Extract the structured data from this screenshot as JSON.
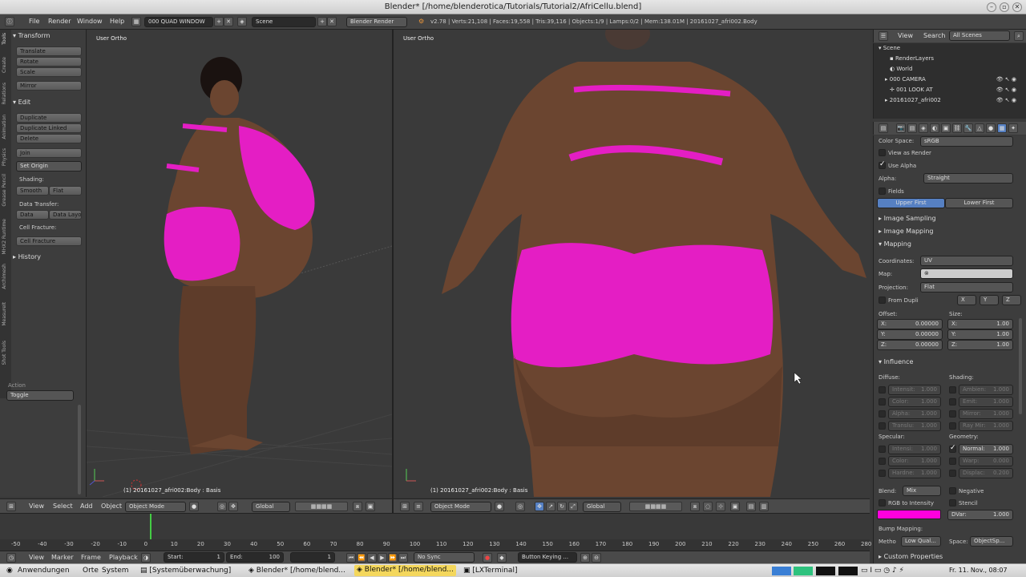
{
  "window": {
    "title": "Blender* [/home/blenderotica/Tutorials/Tutorial2/AfriCellu.blend]"
  },
  "info_header": {
    "menus": [
      "File",
      "Render",
      "Window",
      "Help"
    ],
    "layout": "000 QUAD WINDOW",
    "scene": "Scene",
    "engine": "Blender Render",
    "stats": "v2.78 | Verts:21,108 | Faces:19,558 | Tris:39,116 | Objects:1/9 | Lamps:0/2 | Mem:138.01M | 20161027_afri002.Body"
  },
  "toolshelf": {
    "tabs": [
      "Tools",
      "Create",
      "Relations",
      "Animation",
      "Physics",
      "Grease Pencil",
      "MHX2 Runtime",
      "Archimesh",
      "MeasureIt",
      "Shot Tools"
    ],
    "transform_header": "Transform",
    "transform_buttons": [
      "Translate",
      "Rotate",
      "Scale",
      "Mirror"
    ],
    "edit_header": "Edit",
    "edit_buttons": [
      "Duplicate",
      "Duplicate Linked",
      "Delete",
      "Join"
    ],
    "set_origin": "Set Origin",
    "shading_label": "Shading:",
    "smooth": "Smooth",
    "flat": "Flat",
    "data_transfer_label": "Data Transfer:",
    "data": "Data",
    "data_layo": "Data Layo",
    "cell_fracture_label": "Cell Fracture:",
    "cell_fracture": "Cell Fracture",
    "history_header": "History",
    "action_label": "Action",
    "toggle": "Toggle"
  },
  "viewport_left": {
    "label": "User Ortho",
    "object_info": "(1) 20161027_afri002:Body : Basis"
  },
  "viewport_right": {
    "label": "User Ortho",
    "object_info": "(1) 20161027_afri002:Body : Basis"
  },
  "viewport_header": {
    "view": "View",
    "select": "Select",
    "add": "Add",
    "object": "Object",
    "mode": "Object Mode",
    "orientation": "Global"
  },
  "timeline": {
    "ticks": [
      "-50",
      "-40",
      "-30",
      "-20",
      "-10",
      "0",
      "10",
      "20",
      "30",
      "40",
      "50",
      "60",
      "70",
      "80",
      "90",
      "100",
      "110",
      "120",
      "130",
      "140",
      "150",
      "160",
      "170",
      "180",
      "190",
      "200",
      "210",
      "220",
      "230",
      "240",
      "250",
      "260",
      "280"
    ],
    "view": "View",
    "marker": "Marker",
    "frame": "Frame",
    "playback": "Playback",
    "start": "Start:",
    "start_val": "1",
    "end": "End:",
    "end_val": "100",
    "current": "1",
    "sync": "No Sync",
    "keying": "Button Keying ..."
  },
  "outliner": {
    "view": "View",
    "search": "Search",
    "scenes": "All Scenes",
    "items": [
      "Scene",
      "RenderLayers",
      "World",
      "000 CAMERA",
      "001 LOOK AT",
      "20161027_afri002"
    ]
  },
  "properties": {
    "color_space_label": "Color Space:",
    "color_space": "sRGB",
    "view_as_render": "View as Render",
    "use_alpha": "Use Alpha",
    "alpha_label": "Alpha:",
    "alpha": "Straight",
    "fields": "Fields",
    "upper_first": "Upper First",
    "lower_first": "Lower First",
    "image_sampling": "Image Sampling",
    "image_mapping": "Image Mapping",
    "mapping": "Mapping",
    "coordinates_label": "Coordinates:",
    "coordinates": "UV",
    "map_label": "Map:",
    "projection_label": "Projection:",
    "projection": "Flat",
    "from_dupli": "From Dupli",
    "axes": [
      "X",
      "Y",
      "Z"
    ],
    "offset_label": "Offset:",
    "size_label": "Size:",
    "offset": [
      {
        "axis": "X:",
        "val": "0.00000"
      },
      {
        "axis": "Y:",
        "val": "0.00000"
      },
      {
        "axis": "Z:",
        "val": "0.00000"
      }
    ],
    "size": [
      {
        "axis": "X:",
        "val": "1.00"
      },
      {
        "axis": "Y:",
        "val": "1.00"
      },
      {
        "axis": "Z:",
        "val": "1.00"
      }
    ],
    "influence": "Influence",
    "diffuse_label": "Diffuse:",
    "shading_label": "Shading:",
    "diffuse": [
      {
        "name": "Intensit:",
        "val": "1.000"
      },
      {
        "name": "Color:",
        "val": "1.000"
      },
      {
        "name": "Alpha:",
        "val": "1.000"
      },
      {
        "name": "Translu:",
        "val": "1.000"
      }
    ],
    "shading": [
      {
        "name": "Ambien:",
        "val": "1.000"
      },
      {
        "name": "Emit:",
        "val": "1.000"
      },
      {
        "name": "Mirror:",
        "val": "1.000"
      },
      {
        "name": "Ray Mir:",
        "val": "1.000"
      }
    ],
    "specular_label": "Specular:",
    "geometry_label": "Geometry:",
    "specular": [
      {
        "name": "Intensi:",
        "val": "1.000"
      },
      {
        "name": "Color:",
        "val": "1.000"
      },
      {
        "name": "Hardne:",
        "val": "1.000"
      }
    ],
    "geometry": [
      {
        "name": "Normal:",
        "val": "1.000"
      },
      {
        "name": "Warp:",
        "val": "0.000"
      },
      {
        "name": "Displac:",
        "val": "0.200"
      }
    ],
    "blend_label": "Blend:",
    "blend": "Mix",
    "negative": "Negative",
    "rgb_to_intensity": "RGB to Intensity",
    "stencil": "Stencil",
    "dvar_label": "DVar:",
    "dvar": "1.000",
    "bump_mapping": "Bump Mapping:",
    "method_label": "Metho",
    "method": "Low Qual...",
    "space_label": "Space:",
    "space": "ObjectSp...",
    "custom_properties": "Custom Properties",
    "swatch_color": "#ff00dd"
  },
  "taskbar": {
    "start": "Anwendungen",
    "places": "Orte",
    "system": "System",
    "tasks": [
      "[Systemüberwachung]",
      "Blender* [/home/blend...",
      "Blender* [/home/blend...",
      "[LXTerminal]"
    ],
    "clock": "Fr. 11. Nov., 08:07"
  },
  "colors": {
    "skin": "#6b4530",
    "garment": "#e41ec4",
    "accent": "#5680c2"
  }
}
